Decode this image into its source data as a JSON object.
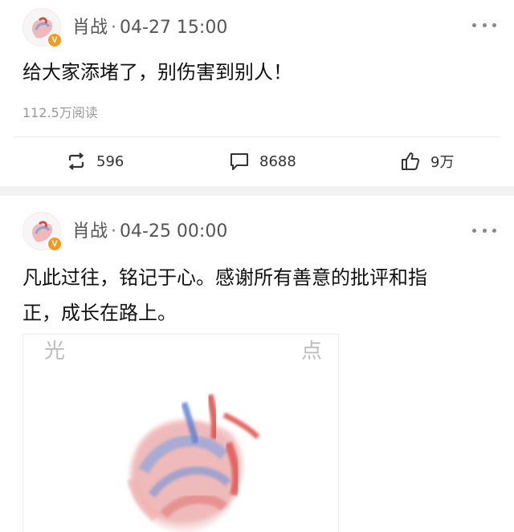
{
  "posts": [
    {
      "author": "肖战",
      "date": "04-27 15:00",
      "text": "给大家添堵了，别伤害到别人！",
      "reads": "112.5万阅读",
      "reposts": "596",
      "comments": "8688",
      "likes": "9万",
      "verified_badge": "V"
    },
    {
      "author": "肖战",
      "date": "04-25 00:00",
      "text_line1": "凡此过往，铭记于心。感谢所有善意的批评和指",
      "text_line2": "正，成长在路上。",
      "verified_badge": "V",
      "image": {
        "left_char": "光",
        "right_char": "点"
      }
    }
  ],
  "colors": {
    "badge": "#f39a1e",
    "heart_red": "#e0534e",
    "heart_blue": "#5b7fd0",
    "separator": "#f2f2f2"
  }
}
